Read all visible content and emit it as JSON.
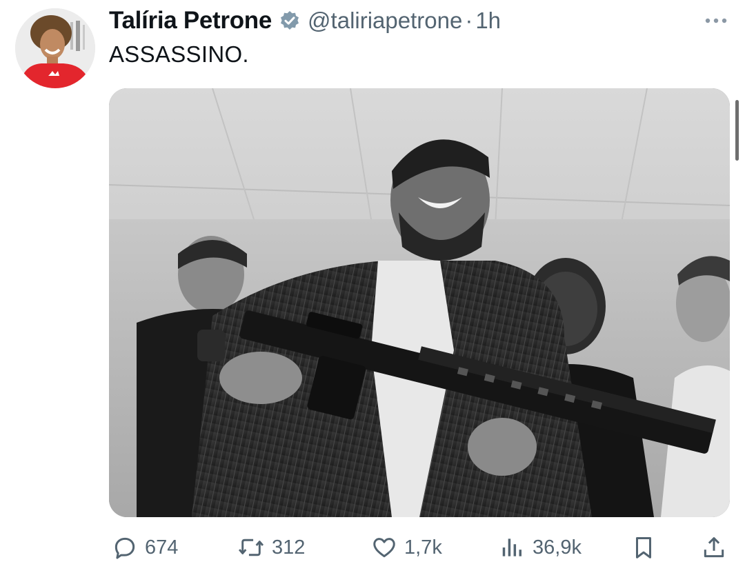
{
  "tweet": {
    "author_name": "Talíria Petrone",
    "handle": "@taliriapetrone",
    "separator": "·",
    "time": "1h",
    "text": "ASSASSINO.",
    "verified": true
  },
  "media": {
    "type": "photo",
    "grayscale": true
  },
  "actions": {
    "replies": "674",
    "retweets": "312",
    "likes": "1,7k",
    "views": "36,9k"
  },
  "icons": {
    "more": "more-horizontal-icon",
    "verified": "verified-badge-icon",
    "reply": "reply-icon",
    "retweet": "retweet-icon",
    "like": "heart-icon",
    "views": "views-icon",
    "bookmark": "bookmark-icon",
    "share": "share-icon"
  },
  "colors": {
    "text": "#0f1419",
    "secondary": "#536471",
    "avatar_shirt": "#e3262d"
  }
}
